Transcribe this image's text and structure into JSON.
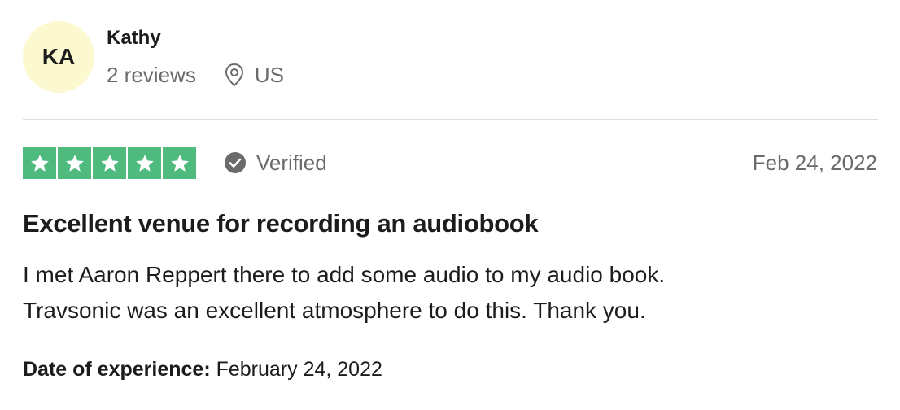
{
  "reviewer": {
    "initials": "KA",
    "name": "Kathy",
    "reviews_count": "2 reviews",
    "location": "US",
    "avatar_bg": "#fcf8cf"
  },
  "rating": {
    "stars": 5,
    "max": 5,
    "color": "#4fba7e",
    "icon": "star-icon"
  },
  "verified_label": "Verified",
  "review_date": "Feb 24, 2022",
  "review": {
    "title": "Excellent venue for recording an audiobook",
    "body_lines": [
      "I met Aaron Reppert there to add some audio to my audio book.",
      "Travsonic was an excellent atmosphere to do this. Thank you."
    ]
  },
  "experience": {
    "label": "Date of experience:",
    "value": "February 24, 2022"
  }
}
